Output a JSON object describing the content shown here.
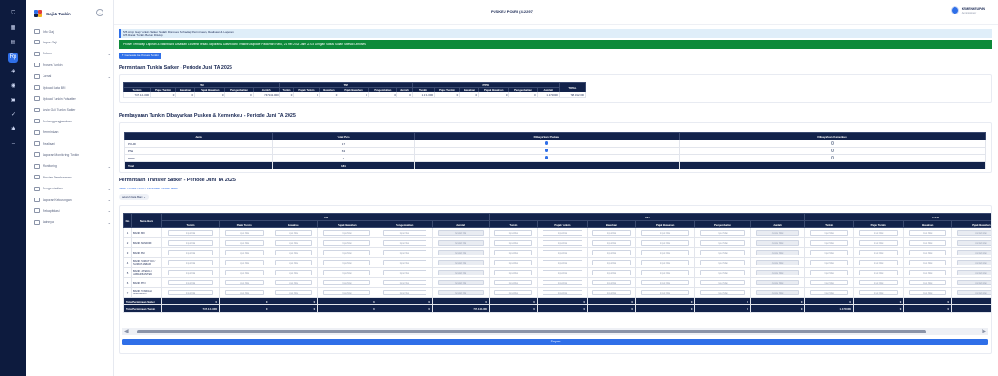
{
  "app": {
    "name": "Gaji & Tunkin",
    "page_title": "PUSKEU POLRI (412297)"
  },
  "user": {
    "name": "KEMENKEUPAN",
    "role": "Administrator"
  },
  "colors": {
    "navy": "#12224a",
    "accent": "#2f6fe8",
    "success": "#0d8a3a",
    "rail": "#0d1b3e"
  },
  "rail": [
    {
      "icon": "shield-icon",
      "glyph": "⛉",
      "active": false
    },
    {
      "icon": "grid-icon",
      "glyph": "▦",
      "active": false
    },
    {
      "icon": "document-icon",
      "glyph": "▤",
      "active": false
    },
    {
      "icon": "pay-icon",
      "glyph": "Rp",
      "active": true
    },
    {
      "icon": "wallet-icon",
      "glyph": "◈",
      "active": false
    },
    {
      "icon": "users-icon",
      "glyph": "◉",
      "active": false
    },
    {
      "icon": "building-icon",
      "glyph": "▣",
      "active": false
    },
    {
      "icon": "check-icon",
      "glyph": "✓",
      "active": false
    },
    {
      "icon": "settings-icon",
      "glyph": "✱",
      "active": false
    },
    {
      "icon": "minus-icon",
      "glyph": "–",
      "active": false
    }
  ],
  "sidebar": [
    {
      "label": "Info Gaji",
      "chevron": false
    },
    {
      "label": "Impor Gaji",
      "chevron": false
    },
    {
      "label": "Rekon",
      "chevron": true
    },
    {
      "label": "Proses Tunkin",
      "chevron": false
    },
    {
      "label": "Jurnal",
      "chevron": true
    },
    {
      "label": "Upload Data BRI",
      "chevron": false
    },
    {
      "label": "Upload Tunkin Polsatker",
      "chevron": false
    },
    {
      "label": "Arsip Gaji Tunkin Satker",
      "chevron": false
    },
    {
      "label": "Pertanggungjawaban",
      "chevron": false
    },
    {
      "label": "Permintaan",
      "chevron": false
    },
    {
      "label": "Realisasi",
      "chevron": false
    },
    {
      "label": "Laporan Monitoring Tunkin",
      "chevron": false
    },
    {
      "label": "Monitoring",
      "chevron": true
    },
    {
      "label": "Rincian Pembayaran",
      "chevron": true
    },
    {
      "label": "Pengembalian",
      "chevron": true
    },
    {
      "label": "Laporan Kekurangan",
      "chevron": true
    },
    {
      "label": "Rekapitulasi",
      "chevron": true
    },
    {
      "label": "Lainnya",
      "chevron": true
    }
  ],
  "notice": {
    "line1": "5/5 Arsip Gaji Tunkin Satker Sudah Diproses Terhadap Permintaan, Realisasi, & Laporan",
    "line2": "0/5 Rapat Tunkin Belum Ditutup"
  },
  "alert": "Proses Terhadap Laporan & Dashboard Disajikan 15 Menit Sekali. Laporan & Dashboard Terakhir Diupdate Pada Hari Rabu, 21 Mei 2025 Jam 21:03 Dengan Status Sudah Selesai Diproses",
  "generate_button": "Generate ke Proses Tunkin",
  "section1": {
    "title": "Permintaan Tunkin Satker - Periode Juni TA 2025",
    "groups": [
      "TNI",
      "TNT",
      "PPPK"
    ],
    "total_label": "TOTAL",
    "columns": [
      "Tunkin",
      "Pajak Tunkin",
      "Bawahan",
      "Pajak Bawahan",
      "Pengembalian",
      "Jumlah"
    ],
    "row": [
      "747.141.000",
      "0",
      "0",
      "0",
      "0",
      "747.141.000",
      "0",
      "0",
      "0",
      "0",
      "0",
      "0",
      "1.171.000",
      "0",
      "0",
      "0",
      "0",
      "1.171.000",
      "748.312.000"
    ]
  },
  "section2": {
    "title": "Pembayaran Tunkin Dibayarkan Puskeu & Kemenkeu - Periode Juni TA 2025",
    "headers": [
      "Jenis",
      "Total Pers",
      "Dibayarkan Puskeu",
      "Dibayarkan Kemenkeu"
    ],
    "rows": [
      {
        "jenis": "POLRI",
        "total": "17",
        "puskeu": true,
        "kemenkeu": false
      },
      {
        "jenis": "PNS",
        "total": "63",
        "puskeu": true,
        "kemenkeu": false
      },
      {
        "jenis": "PPPK",
        "total": "1",
        "puskeu": true,
        "kemenkeu": false
      }
    ],
    "total_label": "Total",
    "total_value": "181"
  },
  "section3": {
    "title": "Permintaan Transfer Satker - Periode Juni TA 2025",
    "breadcrumb": [
      "Satker",
      "Proses Tunkin",
      "Permintaan Transfer Satker"
    ],
    "filter_label": "Seluruh Data Bank",
    "groups": [
      "TNI",
      "TNT",
      "PPPK"
    ],
    "col_no": "No",
    "col_bank": "Nama Bank",
    "sub_columns": [
      "Tunkin",
      "Pajak Tunkin",
      "Bawahan",
      "Pajak Bawahan",
      "Pengembalian",
      "Jumlah"
    ],
    "pppk_columns": [
      "Tunkin",
      "Pajak Tunkin",
      "Bawahan",
      "Pajak Bawahan",
      "Pengembalian"
    ],
    "input_placeholder": "Input Nilai",
    "readonly_placeholder": "Jumlah Nilai",
    "banks": [
      {
        "no": "1",
        "name": "BANK BRI"
      },
      {
        "no": "2",
        "name": "BANK MANDIRI"
      },
      {
        "no": "3",
        "name": "BANK BNI"
      },
      {
        "no": "4",
        "name": "BANK SUMUT DKI / SUMUT JABAR"
      },
      {
        "no": "5",
        "name": "BANK JATENG / JABAR BANTEN"
      },
      {
        "no": "6",
        "name": "BANK BTN"
      },
      {
        "no": "7",
        "name": "BANK SYARIAH INDONESIA"
      }
    ],
    "sum_rows": [
      {
        "label": "Total Permintaan Satker",
        "values": [
          "0",
          "0",
          "0",
          "0",
          "0",
          "0",
          "0",
          "0",
          "0",
          "0",
          "0",
          "0",
          "0",
          "0",
          "0",
          "0",
          "0"
        ]
      },
      {
        "label": "Total Permintaan Tunkin",
        "values": [
          "747.141.000",
          "0",
          "0",
          "0",
          "0",
          "747.141.000",
          "0",
          "0",
          "0",
          "0",
          "0",
          "0",
          "1.171.000",
          "0",
          "0",
          "0",
          "0"
        ]
      }
    ],
    "save_label": "Simpan"
  }
}
